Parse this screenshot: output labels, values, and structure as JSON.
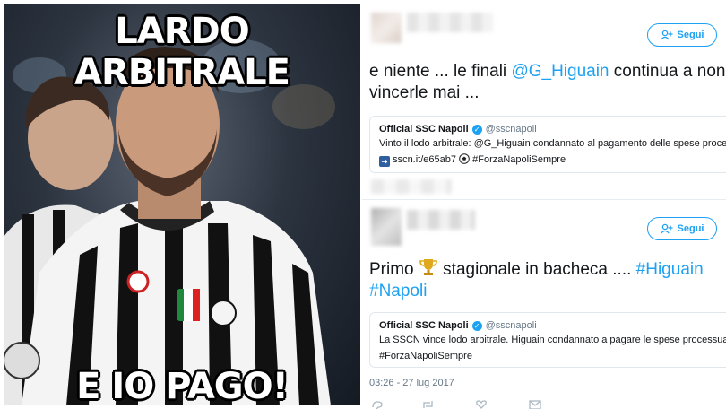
{
  "meme": {
    "top_caption": "LARDO ARBITRALE",
    "bottom_caption": "E IO PAGO!"
  },
  "tweet1": {
    "follow_label": "Segui",
    "text_before": "e niente ... le finali ",
    "mention": "@G_Higuain",
    "text_after": " continua a non vincerle mai ...",
    "quote": {
      "name": "Official SSC Napoli",
      "handle": "@sscnapoli",
      "line1": "Vinto il lodo arbitrale: @G_Higuain condannato al pagamento delle spese processuali",
      "line2_link": "sscn.it/e65ab7",
      "line2_hashtag": "#ForzaNapoliSempre"
    }
  },
  "tweet2": {
    "follow_label": "Segui",
    "text_before": "Primo ",
    "text_mid": " stagionale in bacheca .... ",
    "hashtag1": "#Higuain",
    "hashtag2": "#Napoli",
    "quote": {
      "name": "Official SSC Napoli",
      "handle": "@sscnapoli",
      "line1": "La SSCN vince lodo arbitrale. Higuain condannato a pagare le spese processuali",
      "line2": "#ForzaNapoliSempre"
    },
    "timestamp": "03:26 - 27 lug 2017"
  },
  "colors": {
    "twitter_blue": "#1da1f2",
    "text": "#14171a",
    "muted": "#657786"
  }
}
